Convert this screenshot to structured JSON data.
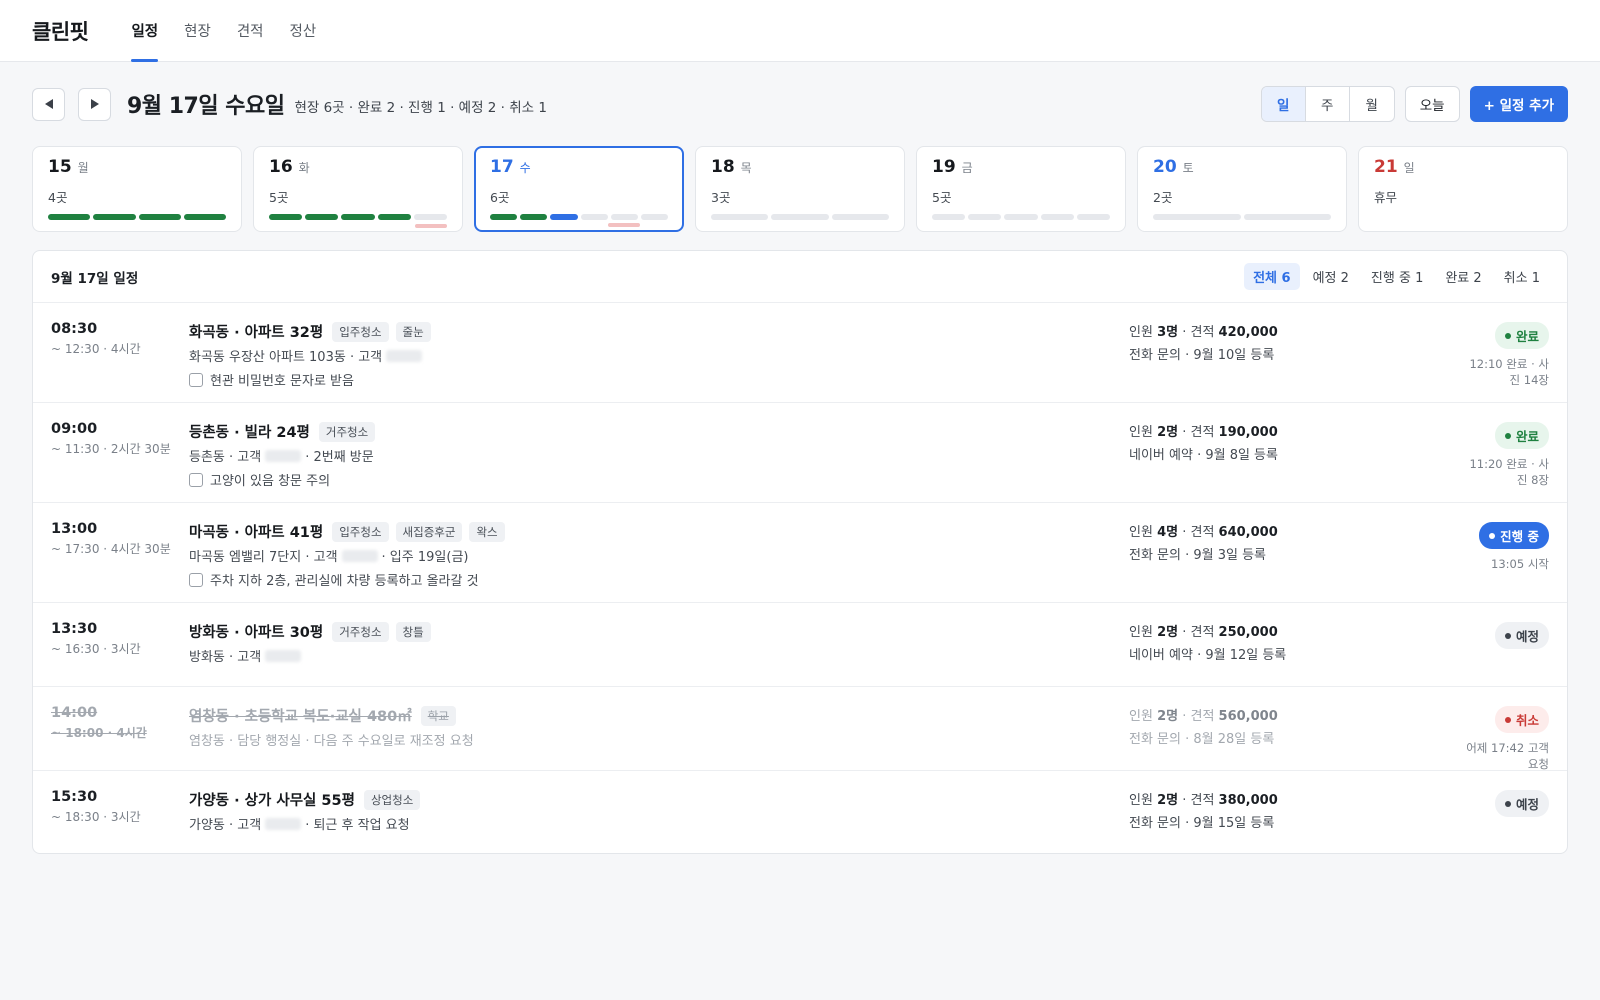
{
  "app": {
    "brand": "클린핏",
    "tabs": [
      {
        "label": "일정",
        "active": true
      },
      {
        "label": "현장",
        "active": false
      },
      {
        "label": "견적",
        "active": false
      },
      {
        "label": "정산",
        "active": false
      }
    ]
  },
  "toolbar": {
    "date_title": "9월 17일 수요일",
    "summary": "현장 6곳 · 완료 2 · 진행 1 · 예정 2 · 취소 1",
    "view_modes": [
      "일",
      "주",
      "월"
    ],
    "today_label": "오늘",
    "add_label": "+ 일정 추가"
  },
  "colors": {
    "accent": "#2f6fe4",
    "done": "#1f8140",
    "cancel_bar": "#f3c0c0",
    "saturday": "#2f6fe4",
    "sunday": "#c93a36"
  },
  "week": [
    {
      "day": "15",
      "weekday": "월",
      "count": "4곳",
      "bars": [
        "done",
        "done",
        "done",
        "done"
      ],
      "cancel": false
    },
    {
      "day": "16",
      "weekday": "화",
      "count": "5곳",
      "bars": [
        "done",
        "done",
        "done",
        "done",
        "empty"
      ],
      "cancel": true
    },
    {
      "day": "17",
      "weekday": "수",
      "count": "6곳",
      "bars": [
        "done",
        "done",
        "progress",
        "empty",
        "empty",
        "empty"
      ],
      "cancel": true,
      "selected": true
    },
    {
      "day": "18",
      "weekday": "목",
      "count": "3곳",
      "bars": [
        "empty",
        "empty",
        "empty"
      ],
      "cancel": false
    },
    {
      "day": "19",
      "weekday": "금",
      "count": "5곳",
      "bars": [
        "empty",
        "empty",
        "empty",
        "empty",
        "empty"
      ],
      "cancel": false
    },
    {
      "day": "20",
      "weekday": "토",
      "count": "2곳",
      "bars": [
        "empty",
        "empty"
      ],
      "cancel": false
    },
    {
      "day": "21",
      "weekday": "일",
      "count": "휴무",
      "bars": [],
      "cancel": false
    }
  ],
  "panel": {
    "title": "9월 17일 일정",
    "filters": [
      "전체 6",
      "예정 2",
      "진행 중 1",
      "완료 2",
      "취소 1"
    ]
  },
  "jobs": [
    {
      "time": "08:30",
      "time_sub": "~ 12:30 · 4시간",
      "title": "화곡동 · 아파트 32평",
      "tags": [
        "입주청소",
        "줄눈"
      ],
      "desc_pre": "화곡동 우장산 아파트 103동 · 고객",
      "desc_post": "",
      "note": "현관 비밀번호 문자로 받음",
      "staff_label": "인원",
      "staff": "3명",
      "quote_label": "견적",
      "quote": "420,000",
      "source": "전화 문의 · 9월 10일 등록",
      "status": "완료",
      "status_type": "done",
      "status_sub": "12:10 완료 · 사진 14장"
    },
    {
      "time": "09:00",
      "time_sub": "~ 11:30 · 2시간 30분",
      "title": "등촌동 · 빌라 24평",
      "tags": [
        "거주청소"
      ],
      "desc_pre": "등촌동 · 고객",
      "desc_post": "· 2번째 방문",
      "note": "고양이 있음 창문 주의",
      "staff_label": "인원",
      "staff": "2명",
      "quote_label": "견적",
      "quote": "190,000",
      "source": "네이버 예약 · 9월 8일 등록",
      "status": "완료",
      "status_type": "done",
      "status_sub": "11:20 완료 · 사진 8장"
    },
    {
      "time": "13:00",
      "time_sub": "~ 17:30 · 4시간 30분",
      "title": "마곡동 · 아파트 41평",
      "tags": [
        "입주청소",
        "새집증후군",
        "왁스"
      ],
      "desc_pre": "마곡동 엠밸리 7단지 · 고객",
      "desc_post": "· 입주 19일(금)",
      "note": "주차 지하 2층, 관리실에 차량 등록하고 올라갈 것",
      "staff_label": "인원",
      "staff": "4명",
      "quote_label": "견적",
      "quote": "640,000",
      "source": "전화 문의 · 9월 3일 등록",
      "status": "진행 중",
      "status_type": "progress",
      "status_sub": "13:05 시작"
    },
    {
      "time": "13:30",
      "time_sub": "~ 16:30 · 3시간",
      "title": "방화동 · 아파트 30평",
      "tags": [
        "거주청소",
        "창틀"
      ],
      "desc_pre": "방화동 · 고객",
      "desc_post": "",
      "note": "",
      "staff_label": "인원",
      "staff": "2명",
      "quote_label": "견적",
      "quote": "250,000",
      "source": "네이버 예약 · 9월 12일 등록",
      "status": "예정",
      "status_type": "planned",
      "status_sub": ""
    },
    {
      "time": "14:00",
      "time_sub": "~ 18:00 · 4시간",
      "title": "염창동 · 초등학교 복도·교실 480㎡",
      "tags": [
        "학교"
      ],
      "desc_pre": "염창동 · 담당 행정실 · 다음 주 수요일로 재조정 요청",
      "desc_post": "",
      "note": "",
      "staff_label": "인원",
      "staff": "2명",
      "quote_label": "견적",
      "quote": "560,000",
      "source": "전화 문의 · 8월 28일 등록",
      "status": "취소",
      "status_type": "cancel",
      "status_sub": "어제 17:42 고객 요청"
    },
    {
      "time": "15:30",
      "time_sub": "~ 18:30 · 3시간",
      "title": "가양동 · 상가 사무실 55평",
      "tags": [
        "상업청소"
      ],
      "desc_pre": "가양동 · 고객",
      "desc_post": "· 퇴근 후 작업 요청",
      "note": "",
      "staff_label": "인원",
      "staff": "2명",
      "quote_label": "견적",
      "quote": "380,000",
      "source": "전화 문의 · 9월 15일 등록",
      "status": "예정",
      "status_type": "planned",
      "status_sub": ""
    }
  ]
}
